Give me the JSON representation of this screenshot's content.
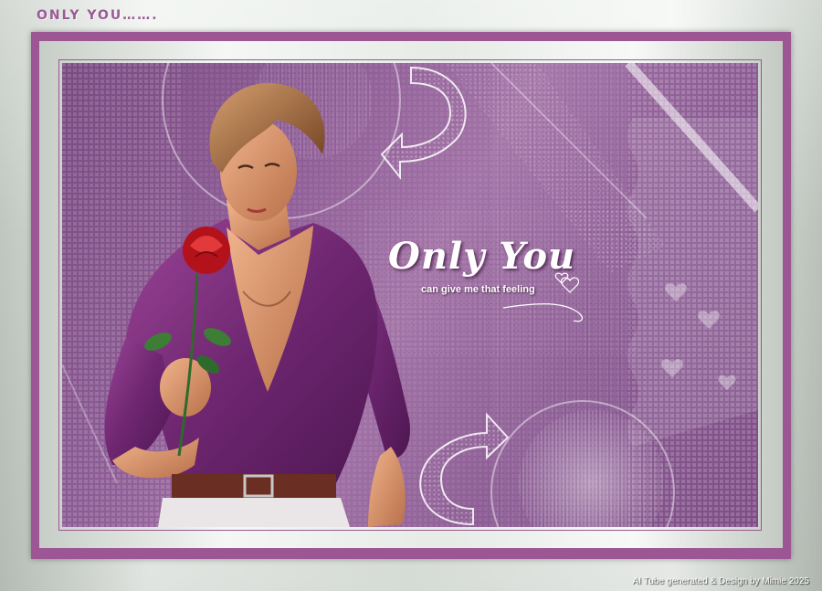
{
  "header": {
    "corner_title": "ONLY YOU……."
  },
  "artwork": {
    "title": "Only You",
    "subtitle": "can give me that feeling",
    "icons": [
      "curved-arrow-icon",
      "heart-icon",
      "rose-icon"
    ]
  },
  "footer": {
    "credit": "AI Tube generated & Design by Mimie 2025"
  },
  "colors": {
    "frame_purple": "#9c5693",
    "canvas_purple": "#8e5d96",
    "silver": "#eef2ee",
    "shirt": "#7b2f78",
    "rose": "#c0141c"
  }
}
